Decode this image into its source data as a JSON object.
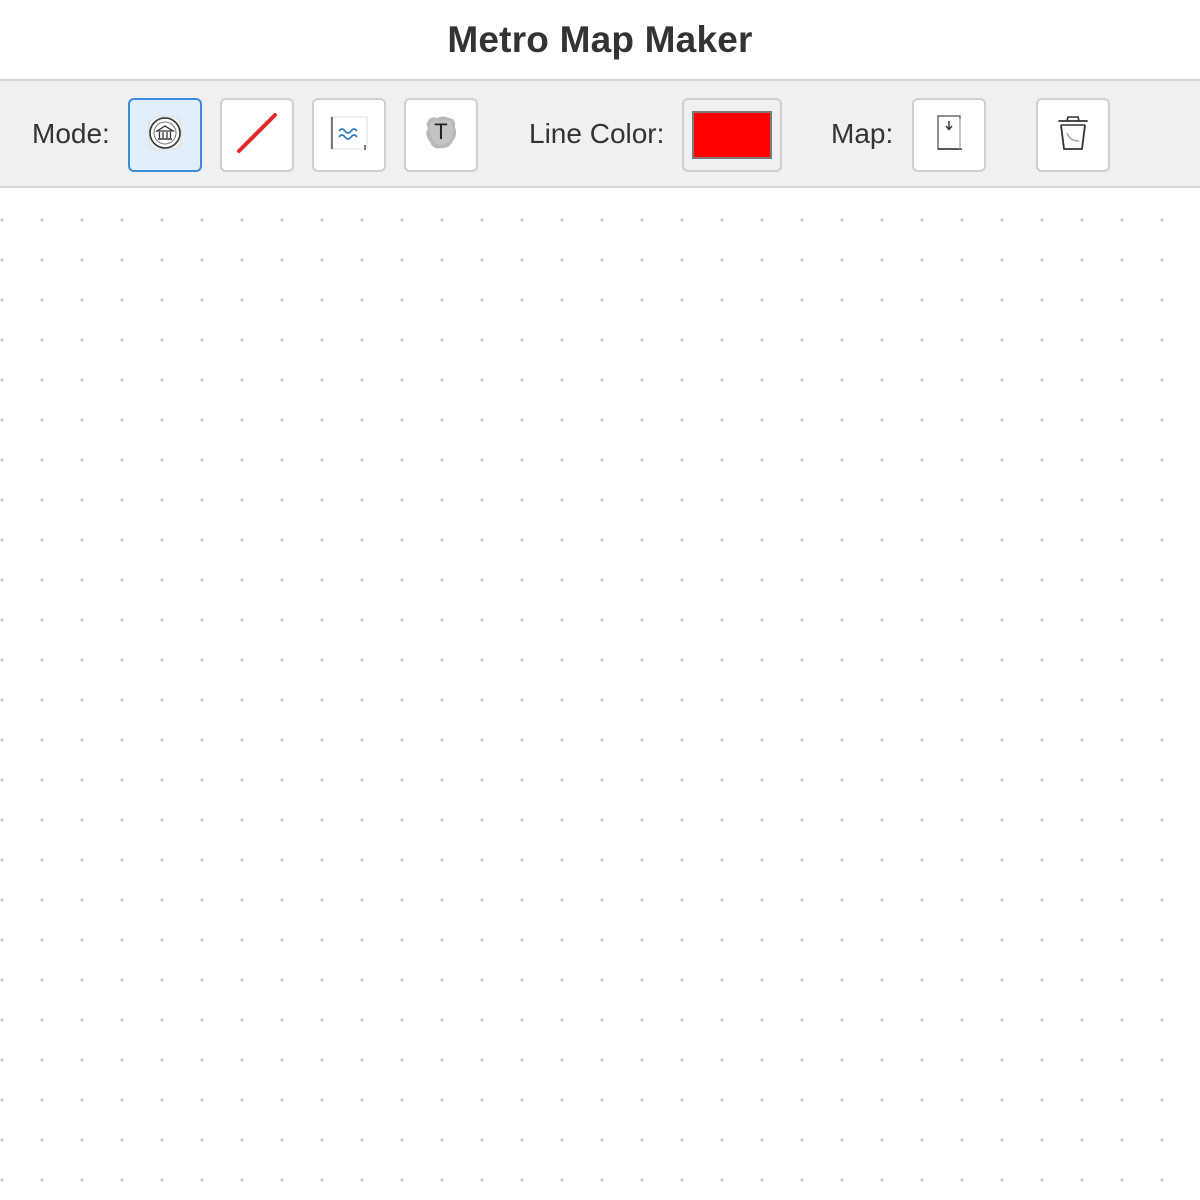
{
  "app": {
    "title": "Metro Map Maker"
  },
  "toolbar": {
    "mode_label": "Mode:",
    "modes": [
      {
        "name": "station",
        "icon": "station-icon",
        "active": true
      },
      {
        "name": "line",
        "icon": "line-draw-icon",
        "active": false
      },
      {
        "name": "water",
        "icon": "water-icon",
        "active": false
      },
      {
        "name": "text",
        "icon": "text-tool-icon",
        "active": false
      }
    ],
    "line_color_label": "Line Color:",
    "line_color": "#ff0000",
    "map_label": "Map:",
    "map_actions": [
      {
        "name": "download",
        "icon": "download-icon"
      },
      {
        "name": "clear",
        "icon": "trash-icon"
      }
    ]
  },
  "colors": {
    "active_border": "#3a8bdd",
    "active_background": "#e3eefb",
    "toolbar_background": "#f0f0f0",
    "grid_dot": "#c8c8c8"
  }
}
